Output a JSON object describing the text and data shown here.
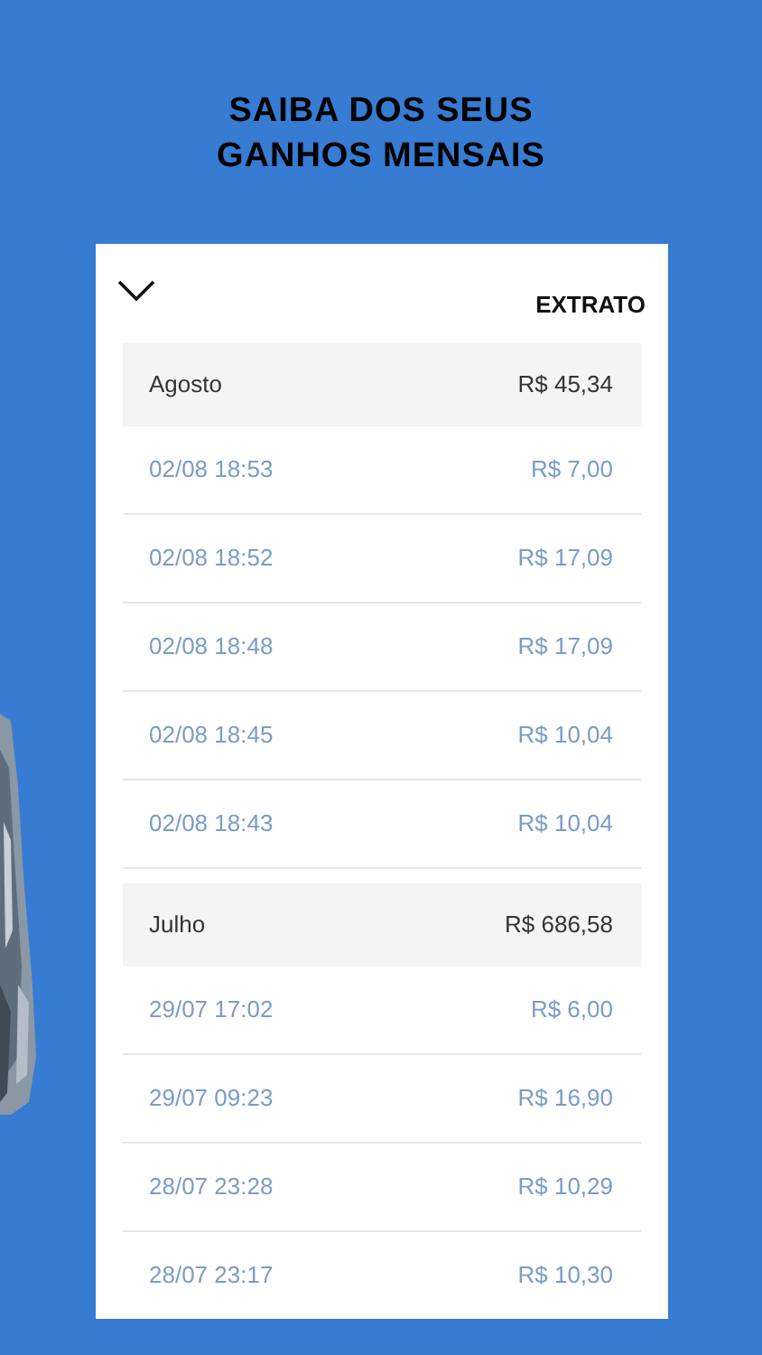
{
  "heading": [
    "SAIBA DOS SEUS",
    "GANHOS MENSAIS"
  ],
  "card": {
    "title": "EXTRATO",
    "groups": [
      {
        "month": "Agosto",
        "total": "R$ 45,34",
        "entries": [
          {
            "date": "02/08 18:53",
            "amount": "R$ 7,00"
          },
          {
            "date": "02/08 18:52",
            "amount": "R$ 17,09"
          },
          {
            "date": "02/08 18:48",
            "amount": "R$ 17,09"
          },
          {
            "date": "02/08 18:45",
            "amount": "R$ 10,04"
          },
          {
            "date": "02/08 18:43",
            "amount": "R$ 10,04"
          }
        ]
      },
      {
        "month": "Julho",
        "total": "R$ 686,58",
        "entries": [
          {
            "date": "29/07 17:02",
            "amount": "R$ 6,00"
          },
          {
            "date": "29/07 09:23",
            "amount": "R$ 16,90"
          },
          {
            "date": "28/07 23:28",
            "amount": "R$ 10,29"
          },
          {
            "date": "28/07 23:17",
            "amount": "R$ 10,30"
          }
        ]
      }
    ]
  }
}
